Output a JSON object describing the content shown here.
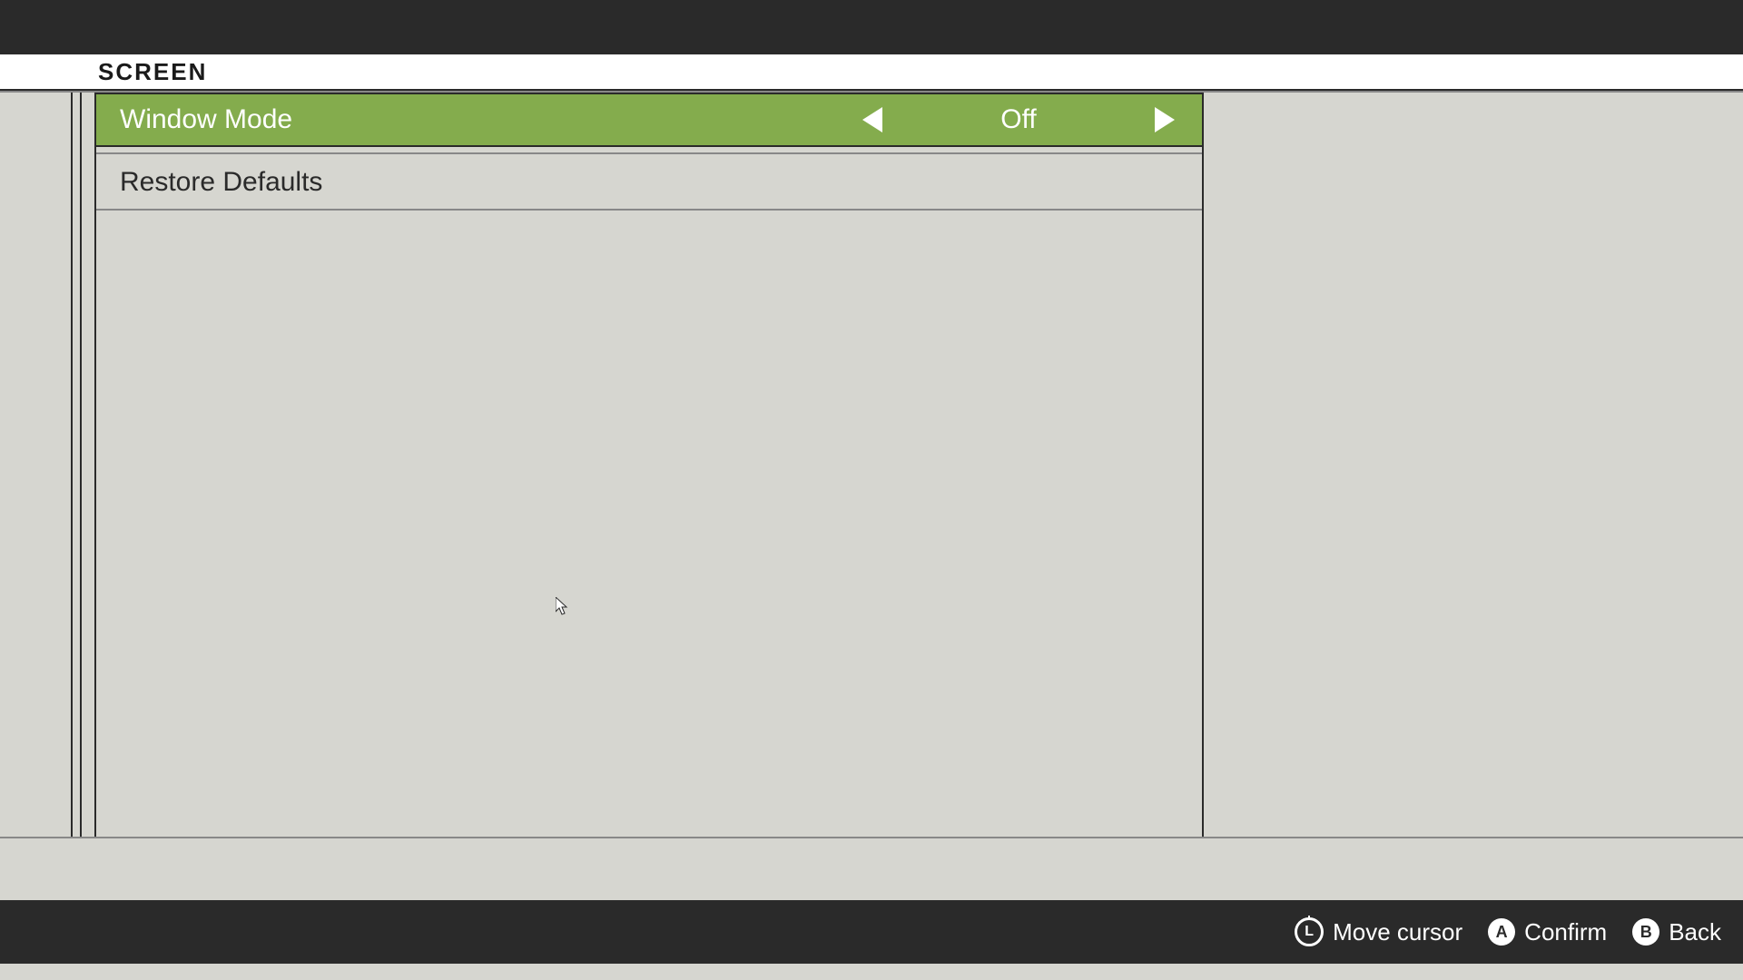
{
  "header": {
    "title": "SCREEN"
  },
  "menu": {
    "items": [
      {
        "label": "Window Mode",
        "value": "Off",
        "selected": true
      },
      {
        "label": "Restore Defaults",
        "selected": false
      }
    ]
  },
  "footer": {
    "stick": {
      "button": "L",
      "label": "Move cursor"
    },
    "confirm": {
      "button": "A",
      "label": "Confirm"
    },
    "back": {
      "button": "B",
      "label": "Back"
    }
  }
}
